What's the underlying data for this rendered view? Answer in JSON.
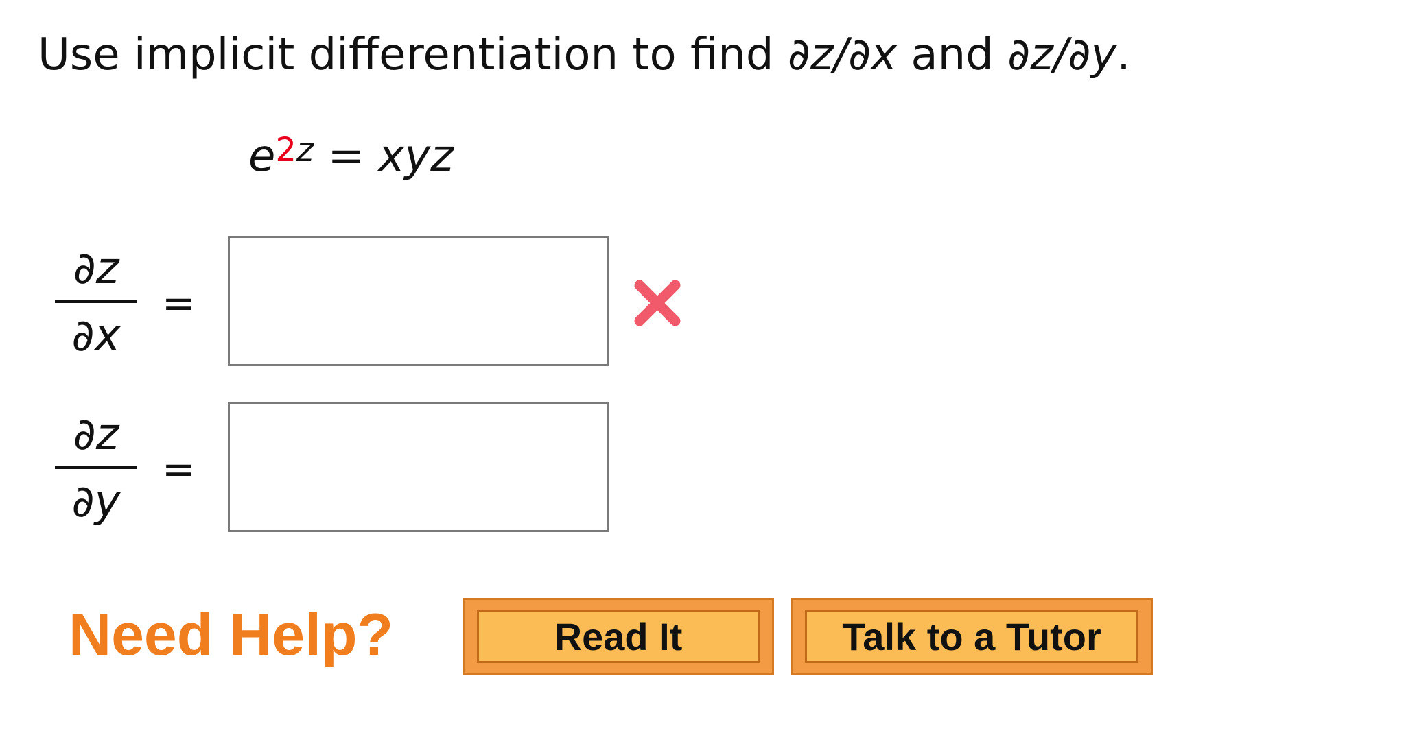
{
  "problem": {
    "instruction_prefix": "Use implicit differentiation to find ",
    "expr_x": "∂z/∂x",
    "instruction_and": " and ",
    "expr_y": "∂z/∂y",
    "instruction_suffix": "."
  },
  "equation": {
    "base": "e",
    "exponent_coefficient": "2",
    "exponent_variable": "z",
    "equals": " = ",
    "rhs": "xyz",
    "coefficient_color": "#e8001c"
  },
  "answers": [
    {
      "numerator": "∂z",
      "denominator": "∂x",
      "equals": "=",
      "value": "",
      "status": "incorrect"
    },
    {
      "numerator": "∂z",
      "denominator": "∂y",
      "equals": "=",
      "value": "",
      "status": "unanswered"
    }
  ],
  "help": {
    "label": "Need Help?",
    "read_it_label": "Read It",
    "tutor_label": "Talk to a Tutor",
    "label_color": "#f07d1e",
    "button_color": "#fcbc55"
  },
  "icons": {
    "incorrect": "incorrect-x-icon"
  },
  "colors": {
    "incorrect_mark": "#f05a6b"
  }
}
